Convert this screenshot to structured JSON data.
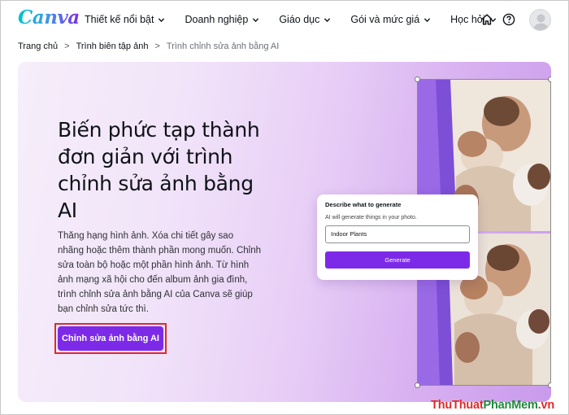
{
  "brand": {
    "logo": "Canva",
    "accent": "#7d2ae8"
  },
  "nav": {
    "items": [
      {
        "label": "Thiết kế nổi bật",
        "icon": "chevron-down-icon"
      },
      {
        "label": "Doanh nghiệp",
        "icon": "chevron-down-icon"
      },
      {
        "label": "Giáo dục",
        "icon": "chevron-down-icon"
      },
      {
        "label": "Gói và mức giá",
        "icon": "chevron-down-icon"
      },
      {
        "label": "Học hỏi",
        "icon": "chevron-down-icon"
      }
    ],
    "right_icons": [
      "home-icon",
      "help-icon",
      "avatar"
    ]
  },
  "breadcrumb": {
    "items": [
      "Trang chủ",
      "Trình biên tập ảnh"
    ],
    "current": "Trình chỉnh sửa ảnh bằng AI",
    "separator": ">"
  },
  "hero": {
    "title": "Biến phức tạp thành đơn giản với trình chỉnh sửa ảnh bằng AI",
    "description": "Thăng hạng hình ảnh. Xóa chi tiết gây sao nhãng hoặc thêm thành phần mong muốn. Chỉnh sửa toàn bộ hoặc một phần hình ảnh. Từ hình ảnh mạng xã hội cho đến album ảnh gia đình, trình chỉnh sửa ảnh bằng AI của Canva sẽ giúp bạn chỉnh sửa tức thì.",
    "cta_label": "Chỉnh sửa ảnh bằng AI",
    "cta_highlight_color": "#e02a2a"
  },
  "prompt_card": {
    "title": "Describe what to generate",
    "subtitle": "AI will generate things in your photo.",
    "input_value": "Indoor Plants",
    "button_label": "Generate"
  },
  "watermark": {
    "part1": "ThuThuat",
    "part2": "PhanMem",
    "part3": ".vn"
  }
}
